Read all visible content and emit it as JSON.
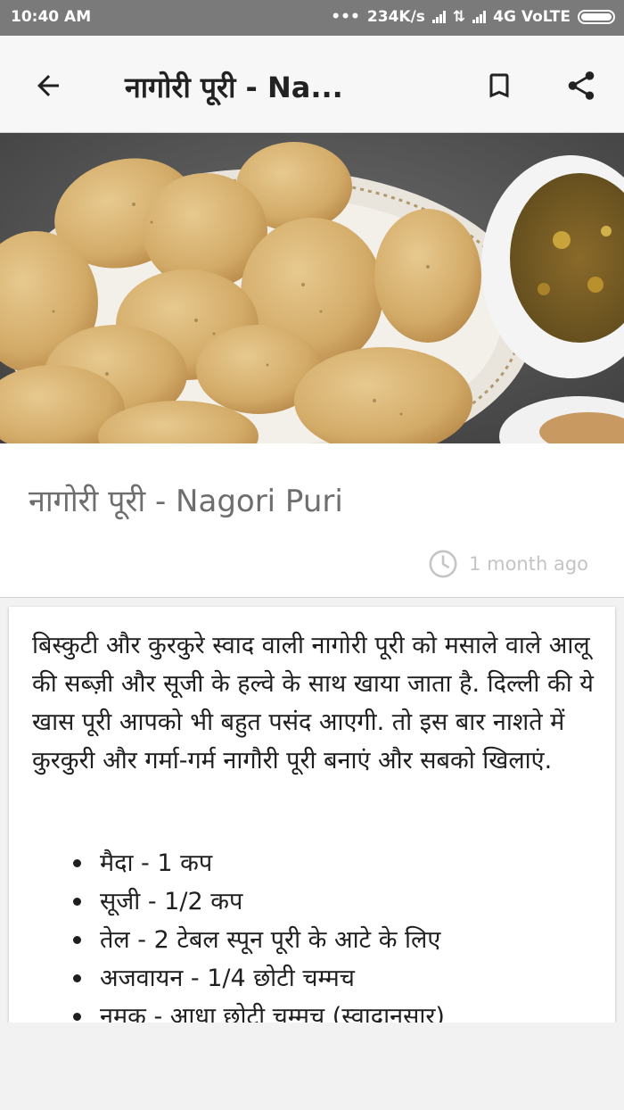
{
  "status_bar": {
    "time": "10:40 AM",
    "dots": "•••",
    "speed": "234K/s",
    "network": "4G VoLTE"
  },
  "app_bar": {
    "title": "नागोरी पूरी - Na...",
    "icons": {
      "back": "arrow-back-icon",
      "bookmark": "bookmark-icon",
      "share": "share-icon"
    }
  },
  "recipe": {
    "title": "नागोरी पूरी - Nagori Puri",
    "posted": "1 month ago",
    "description": "बिस्कुटी और कुरकुरे स्वाद वाली नागोरी पूरी को मसाले वाले आलू की सब्ज़ी और सूजी के हल्वे के साथ खाया जाता है. दिल्ली की ये खास पूरी आपको भी बहुत पसंद आएगी. तो इस बार नाशते में कुरकुरी और गर्मा-गर्म नागौरी पूरी बनाएं और सबको खिलाएं.",
    "ingredients": [
      "मैदा - 1 कप",
      "सूजी - 1/2 कप",
      "तेल - 2 टेबल स्पून पूरी के आटे के लिए",
      "अजवायन - 1/4 छोटी चम्मच",
      "नमक - आधा छोटी चम्मच (स्वादानुसार)"
    ]
  },
  "colors": {
    "status_bar": "#7a7a7a",
    "app_bar": "#f7f7f7",
    "title_text": "#6e6e6e",
    "meta_text": "#c4c4c4"
  }
}
